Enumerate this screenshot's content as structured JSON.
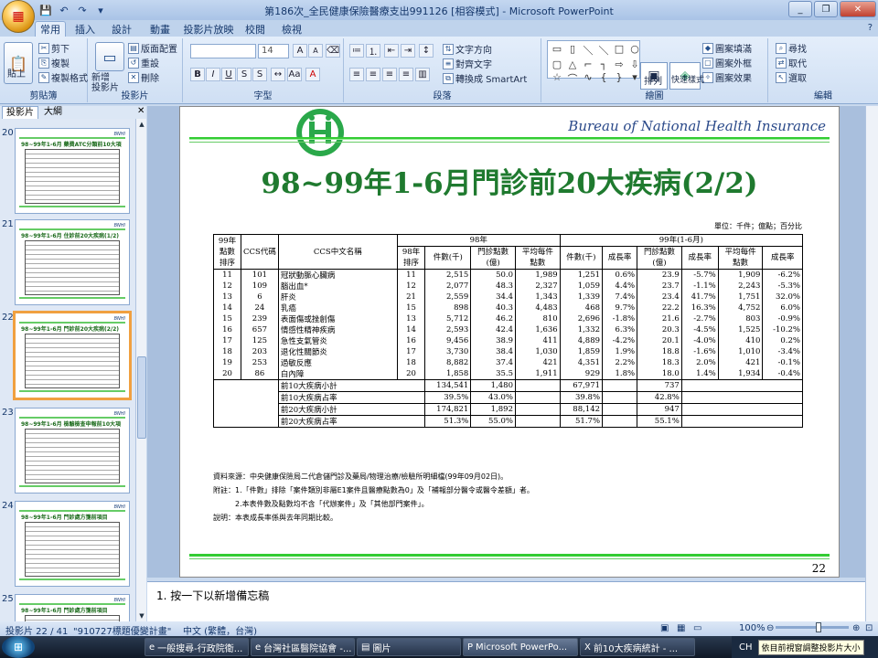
{
  "window": {
    "title": "第186次_全民健康保險醫療支出991126 [相容模式] - Microsoft PowerPoint"
  },
  "tabs": [
    "常用",
    "插入",
    "設計",
    "動畫",
    "投影片放映",
    "校閱",
    "檢視"
  ],
  "ribbon": {
    "clipboard": {
      "label": "剪貼簿",
      "paste": "貼上",
      "cut": "剪下",
      "copy": "複製",
      "format_painter": "複製格式"
    },
    "slides": {
      "label": "投影片",
      "new_slide": "新增\n投影片",
      "layout": "版面配置",
      "reset": "重設",
      "delete": "刪除"
    },
    "font": {
      "label": "字型",
      "size": "14"
    },
    "paragraph": {
      "label": "段落",
      "text_direction": "文字方向",
      "align_text": "對齊文字",
      "smartart": "轉換成 SmartArt"
    },
    "drawing": {
      "label": "繪圖",
      "arrange": "排列",
      "quick_styles": "快速樣式",
      "shape_fill": "圖案填滿",
      "shape_outline": "圖案外框",
      "shape_effects": "圖案效果"
    },
    "editing": {
      "label": "編輯",
      "find": "尋找",
      "replace": "取代",
      "select": "選取"
    }
  },
  "panel": {
    "tab_slides": "投影片",
    "tab_outline": "大綱"
  },
  "thumbnails": [
    {
      "num": "20",
      "title": "98~99年1-6月 藥費ATC分類前10大項"
    },
    {
      "num": "21",
      "title": "98~99年1-6月 住診前20大疾病(1/2)"
    },
    {
      "num": "22",
      "title": "98~99年1-6月 門診前20大疾病(2/2)"
    },
    {
      "num": "23",
      "title": "98~99年1-6月 檢驗檢查申報前10大項"
    },
    {
      "num": "24",
      "title": "98~99年1-6月 門診處方箋前項目"
    },
    {
      "num": "25",
      "title": "98~99年1-6月 門診處方箋前項目"
    }
  ],
  "slide": {
    "header": "Bureau of  National Health Insurance",
    "title": "98~99年1-6月門診前20大疾病(2/2)",
    "unit": "單位：千件；億點；百分比",
    "page_number": "22",
    "headers": {
      "rank99": "99年\n點數\n排序",
      "ccs": "CCS代碼",
      "name": "CCS中文名稱",
      "y98": "98年",
      "y99": "99年(1-6月)",
      "rank98": "98年\n排序",
      "cases": "件數(千)",
      "points": "門診點數\n(億)",
      "avg": "平均每件\n點數",
      "growth": "成長率"
    },
    "rows": [
      [
        "11",
        "101",
        "冠狀動脈心臟病",
        "11",
        "2,515",
        "50.0",
        "1,989",
        "1,251",
        "0.6%",
        "23.9",
        "-5.7%",
        "1,909",
        "-6.2%"
      ],
      [
        "12",
        "109",
        "腦出血*",
        "12",
        "2,077",
        "48.3",
        "2,327",
        "1,059",
        "4.4%",
        "23.7",
        "-1.1%",
        "2,243",
        "-5.3%"
      ],
      [
        "13",
        "6",
        "肝炎",
        "21",
        "2,559",
        "34.4",
        "1,343",
        "1,339",
        "7.4%",
        "23.4",
        "41.7%",
        "1,751",
        "32.0%"
      ],
      [
        "14",
        "24",
        "乳癌",
        "15",
        "898",
        "40.3",
        "4,483",
        "468",
        "9.7%",
        "22.2",
        "16.3%",
        "4,752",
        "6.0%"
      ],
      [
        "15",
        "239",
        "表面傷或挫創傷",
        "13",
        "5,712",
        "46.2",
        "810",
        "2,696",
        "-1.8%",
        "21.6",
        "-2.7%",
        "803",
        "-0.9%"
      ],
      [
        "16",
        "657",
        "情感性精神疾病",
        "14",
        "2,593",
        "42.4",
        "1,636",
        "1,332",
        "6.3%",
        "20.3",
        "-4.5%",
        "1,525",
        "-10.2%"
      ],
      [
        "17",
        "125",
        "急性支氣管炎",
        "16",
        "9,456",
        "38.9",
        "411",
        "4,889",
        "-4.2%",
        "20.1",
        "-4.0%",
        "410",
        "0.2%"
      ],
      [
        "18",
        "203",
        "退化性關節炎",
        "17",
        "3,730",
        "38.4",
        "1,030",
        "1,859",
        "1.9%",
        "18.8",
        "-1.6%",
        "1,010",
        "-3.4%"
      ],
      [
        "19",
        "253",
        "過敏反應",
        "18",
        "8,882",
        "37.4",
        "421",
        "4,351",
        "2.2%",
        "18.3",
        "2.0%",
        "421",
        "-0.1%"
      ],
      [
        "20",
        "86",
        "白內障",
        "20",
        "1,858",
        "35.5",
        "1,911",
        "929",
        "1.8%",
        "18.0",
        "1.4%",
        "1,934",
        "-0.4%"
      ]
    ],
    "summary": [
      [
        "前10大疾病小計",
        "134,541",
        "1,480",
        "",
        "67,971",
        "",
        "737"
      ],
      [
        "前10大疾病占率",
        "39.5%",
        "43.0%",
        "",
        "39.8%",
        "",
        "42.8%"
      ],
      [
        "前20大疾病小計",
        "174,821",
        "1,892",
        "",
        "88,142",
        "",
        "947"
      ],
      [
        "前20大疾病占率",
        "51.3%",
        "55.0%",
        "",
        "51.7%",
        "",
        "55.1%"
      ]
    ],
    "notes": [
      "資料來源：中央健康保險局二代倉儲門診及藥局/物理治療/檢驗所明細檔(99年09月02日)。",
      "附註：1.「件數」排除「案件類別非屬E1案件且醫療點數為0」及「補報部分醫令或醫令差額」者。",
      "2.本表件數及點數均不含「代辦案件」及「其他部門案件」。",
      "說明：本表成長率係與去年同期比較。"
    ]
  },
  "notes_pane": "1.  按一下以新增備忘稿",
  "status": {
    "slide": "投影片 22 / 41",
    "theme": "\"910727標題優變計畫\"",
    "lang": "中文 (繁體，台灣)",
    "zoom": "100%"
  },
  "taskbar": {
    "items": [
      "一般搜尋-行政院衛...",
      "台灣社區醫院協會 -...",
      "圖片",
      "Microsoft PowerPo...",
      "前10大疾病統計 - ..."
    ],
    "tray": "CH",
    "tooltip": "依目前視窗調整投影片大小"
  }
}
